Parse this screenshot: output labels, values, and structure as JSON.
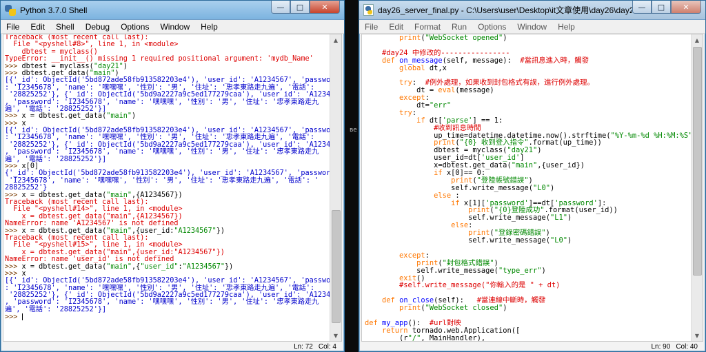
{
  "shell": {
    "title": "Python 3.7.0 Shell",
    "menu": [
      "File",
      "Edit",
      "Shell",
      "Debug",
      "Options",
      "Window",
      "Help"
    ],
    "lines": [
      [
        {
          "t": "Traceback (most recent call last):",
          "c": "c-err"
        }
      ],
      [
        {
          "t": "  File \"<pyshell#8>\", line 1, in <module>",
          "c": "c-err"
        }
      ],
      [
        {
          "t": "    dbtest = myclass()",
          "c": "c-err"
        }
      ],
      [
        {
          "t": "TypeError: __init__() missing 1 required positional argument: 'mydb_Name'",
          "c": "c-err"
        }
      ],
      [
        {
          "t": ">>> ",
          "c": "c-prompt"
        },
        {
          "t": "dbtest = myclass(",
          "c": "c-code"
        },
        {
          "t": "\"day21\"",
          "c": "c-str"
        },
        {
          "t": ")",
          "c": "c-code"
        }
      ],
      [
        {
          "t": ">>> ",
          "c": "c-prompt"
        },
        {
          "t": "dbtest.get_data(",
          "c": "c-code"
        },
        {
          "t": "\"main\"",
          "c": "c-str"
        },
        {
          "t": ")",
          "c": "c-code"
        }
      ],
      [
        {
          "t": "[{'_id': ObjectId('5bd872ade58fb913582203e4'), 'user_id': 'A1234567', 'password'",
          "c": "c-out"
        }
      ],
      [
        {
          "t": ": 'I2345678', 'name': '嘿嘿嘿', '性別': '男', '住址': '忠孝東路走九遍', '電話':",
          "c": "c-out"
        }
      ],
      [
        {
          "t": " '28825252'}, {'_id': ObjectId('5bd9a2227a9c5ed177279caa'), 'user_id': 'A1234567'",
          "c": "c-out"
        }
      ],
      [
        {
          "t": ", 'password': 'I2345678', 'name': '嘿嘿嘿', '性別': '男', '住址': '忠孝東路走九",
          "c": "c-out"
        }
      ],
      [
        {
          "t": "遍', '電話': '28825252'}]",
          "c": "c-out"
        }
      ],
      [
        {
          "t": ">>> ",
          "c": "c-prompt"
        },
        {
          "t": "x = dbtest.get_data(",
          "c": "c-code"
        },
        {
          "t": "\"main\"",
          "c": "c-str"
        },
        {
          "t": ")",
          "c": "c-code"
        }
      ],
      [
        {
          "t": ">>> ",
          "c": "c-prompt"
        },
        {
          "t": "x",
          "c": "c-code"
        }
      ],
      [
        {
          "t": "[{'_id': ObjectId('5bd872ade58fb913582203e4'), 'user_id': 'A1234567', 'password'",
          "c": "c-out"
        }
      ],
      [
        {
          "t": ": 'I2345678', 'name': '嘿嘿嘿', '性別': '男', '住址': '忠孝東路走九遍', '電話':",
          "c": "c-out"
        }
      ],
      [
        {
          "t": " '28825252'}, {'_id': ObjectId('5bd9a2227a9c5ed177279caa'), 'user_id': 'A1234567'",
          "c": "c-out"
        }
      ],
      [
        {
          "t": ", 'password': 'I2345678', 'name': '嘿嘿嘿', '性別': '男', '住址': '忠孝東路走九",
          "c": "c-out"
        }
      ],
      [
        {
          "t": "遍', '電話': '28825252'}]",
          "c": "c-out"
        }
      ],
      [
        {
          "t": ">>> ",
          "c": "c-prompt"
        },
        {
          "t": "x[0]",
          "c": "c-code"
        }
      ],
      [
        {
          "t": "{'_id': ObjectId('5bd872ade58fb913582203e4'), 'user_id': 'A1234567', 'password':",
          "c": "c-out"
        }
      ],
      [
        {
          "t": " 'I2345678', 'name': '嘿嘿嘿', '性別': '男', '住址': '忠孝東路走九遍', '電話': '",
          "c": "c-out"
        }
      ],
      [
        {
          "t": "28825252'}",
          "c": "c-out"
        }
      ],
      [
        {
          "t": ">>> ",
          "c": "c-prompt"
        },
        {
          "t": "x = dbtest.get_data(",
          "c": "c-code"
        },
        {
          "t": "\"main\"",
          "c": "c-str"
        },
        {
          "t": ",{A1234567})",
          "c": "c-code"
        }
      ],
      [
        {
          "t": "Traceback (most recent call last):",
          "c": "c-err"
        }
      ],
      [
        {
          "t": "  File \"<pyshell#14>\", line 1, in <module>",
          "c": "c-err"
        }
      ],
      [
        {
          "t": "    x = dbtest.get_data(\"main\",{A1234567})",
          "c": "c-err"
        }
      ],
      [
        {
          "t": "NameError: name 'A1234567' is not defined",
          "c": "c-err"
        }
      ],
      [
        {
          "t": ">>> ",
          "c": "c-prompt"
        },
        {
          "t": "x = dbtest.get_data(",
          "c": "c-code"
        },
        {
          "t": "\"main\"",
          "c": "c-str"
        },
        {
          "t": ",{user_id:",
          "c": "c-code"
        },
        {
          "t": "\"A1234567\"",
          "c": "c-str"
        },
        {
          "t": "})",
          "c": "c-code"
        }
      ],
      [
        {
          "t": "Traceback (most recent call last):",
          "c": "c-err"
        }
      ],
      [
        {
          "t": "  File \"<pyshell#15>\", line 1, in <module>",
          "c": "c-err"
        }
      ],
      [
        {
          "t": "    x = dbtest.get_data(\"main\",{user_id:\"A1234567\"})",
          "c": "c-err"
        }
      ],
      [
        {
          "t": "NameError: name 'user_id' is not defined",
          "c": "c-err"
        }
      ],
      [
        {
          "t": ">>> ",
          "c": "c-prompt"
        },
        {
          "t": "x = dbtest.get_data(",
          "c": "c-code"
        },
        {
          "t": "\"main\"",
          "c": "c-str"
        },
        {
          "t": ",{",
          "c": "c-code"
        },
        {
          "t": "\"user_id\"",
          "c": "c-str"
        },
        {
          "t": ":",
          "c": "c-code"
        },
        {
          "t": "\"A1234567\"",
          "c": "c-str"
        },
        {
          "t": "})",
          "c": "c-code"
        }
      ],
      [
        {
          "t": ">>> ",
          "c": "c-prompt"
        },
        {
          "t": "x",
          "c": "c-code"
        }
      ],
      [
        {
          "t": "[{'_id': ObjectId('5bd872ade58fb913582203e4'), 'user_id': 'A1234567', 'password'",
          "c": "c-out"
        }
      ],
      [
        {
          "t": ": 'I2345678', 'name': '嘿嘿嘿', '性別': '男', '住址': '忠孝東路走九遍', '電話':",
          "c": "c-out"
        }
      ],
      [
        {
          "t": " '28825252'}, {'_id': ObjectId('5bd9a2227a9c5ed177279caa'), 'user_id': 'A1234567'",
          "c": "c-out"
        }
      ],
      [
        {
          "t": ", 'password': 'I2345678', 'name': '嘿嘿嘿', '性別': '男', '住址': '忠孝東路走九",
          "c": "c-out"
        }
      ],
      [
        {
          "t": "遍', '電話': '28825252'}]",
          "c": "c-out"
        }
      ],
      [
        {
          "t": ">>> ",
          "c": "c-prompt"
        }
      ]
    ],
    "status": {
      "ln": "Ln: 72",
      "col": "Col: 4"
    }
  },
  "editor": {
    "title": "day26_server_final.py - C:\\Users\\user\\Desktop\\it文章使用\\day26\\day26_server_fi...",
    "menu": [
      "File",
      "Edit",
      "Format",
      "Run",
      "Options",
      "Window",
      "Help"
    ],
    "lines": [
      [
        {
          "t": "        "
        },
        {
          "t": "print",
          "c": "c-kw"
        },
        {
          "t": "("
        },
        {
          "t": "\"WebSocket opened\"",
          "c": "c-str"
        },
        {
          "t": ")"
        }
      ],
      [
        {
          "t": ""
        }
      ],
      [
        {
          "t": "    #day24 中修改的----------------",
          "c": "c-cmt"
        }
      ],
      [
        {
          "t": "    "
        },
        {
          "t": "def ",
          "c": "c-kw"
        },
        {
          "t": "on_message",
          "c": "c-def"
        },
        {
          "t": "(self, message):  "
        },
        {
          "t": "#當訊息進入時，觸發",
          "c": "c-cmt"
        }
      ],
      [
        {
          "t": "        "
        },
        {
          "t": "global ",
          "c": "c-kw"
        },
        {
          "t": "dt,x"
        }
      ],
      [
        {
          "t": ""
        }
      ],
      [
        {
          "t": "        "
        },
        {
          "t": "try",
          "c": "c-kw"
        },
        {
          "t": ":  "
        },
        {
          "t": "#例外處理，如果收到封包格式有誤，進行例外處理。",
          "c": "c-cmt"
        }
      ],
      [
        {
          "t": "            dt = "
        },
        {
          "t": "eval",
          "c": "c-kw"
        },
        {
          "t": "(message)"
        }
      ],
      [
        {
          "t": "        "
        },
        {
          "t": "except",
          "c": "c-kw"
        },
        {
          "t": ":"
        }
      ],
      [
        {
          "t": "            dt="
        },
        {
          "t": "\"err\"",
          "c": "c-str"
        }
      ],
      [
        {
          "t": "        "
        },
        {
          "t": "try",
          "c": "c-kw"
        },
        {
          "t": ":"
        }
      ],
      [
        {
          "t": "            "
        },
        {
          "t": "if ",
          "c": "c-kw"
        },
        {
          "t": "dt["
        },
        {
          "t": "'parse'",
          "c": "c-str"
        },
        {
          "t": "] == 1:"
        }
      ],
      [
        {
          "t": "                "
        },
        {
          "t": "#收到訊息時間",
          "c": "c-cmt"
        }
      ],
      [
        {
          "t": "                up_time=datetime.datetime.now().strftime("
        },
        {
          "t": "\"%Y-%m-%d %H:%M:%S\"",
          "c": "c-str"
        },
        {
          "t": ")"
        }
      ],
      [
        {
          "t": "                "
        },
        {
          "t": "print",
          "c": "c-kw"
        },
        {
          "t": "("
        },
        {
          "t": "\"{0} 收到登入指令\"",
          "c": "c-str"
        },
        {
          "t": ".format(up_time))"
        }
      ],
      [
        {
          "t": "                dbtest = myclass("
        },
        {
          "t": "\"day21\"",
          "c": "c-str"
        },
        {
          "t": ")"
        }
      ],
      [
        {
          "t": "                user_id=dt["
        },
        {
          "t": "'user_id'",
          "c": "c-str"
        },
        {
          "t": "]"
        }
      ],
      [
        {
          "t": "                x=dbtest.get_data("
        },
        {
          "t": "\"main\"",
          "c": "c-str"
        },
        {
          "t": ",{user_id})"
        }
      ],
      [
        {
          "t": "                "
        },
        {
          "t": "if ",
          "c": "c-kw"
        },
        {
          "t": "x[0]== 0:"
        }
      ],
      [
        {
          "t": "                    "
        },
        {
          "t": "print",
          "c": "c-kw"
        },
        {
          "t": "("
        },
        {
          "t": "\"登陸帳號錯誤\"",
          "c": "c-str"
        },
        {
          "t": ")"
        }
      ],
      [
        {
          "t": "                    self.write_message("
        },
        {
          "t": "\"L0\"",
          "c": "c-str"
        },
        {
          "t": ")"
        }
      ],
      [
        {
          "t": "                "
        },
        {
          "t": "else ",
          "c": "c-kw"
        },
        {
          "t": ":"
        }
      ],
      [
        {
          "t": "                    "
        },
        {
          "t": "if ",
          "c": "c-kw"
        },
        {
          "t": "x[1]["
        },
        {
          "t": "'password'",
          "c": "c-str"
        },
        {
          "t": "]==dt["
        },
        {
          "t": "'password'",
          "c": "c-str"
        },
        {
          "t": "]:"
        }
      ],
      [
        {
          "t": "                        "
        },
        {
          "t": "print",
          "c": "c-kw"
        },
        {
          "t": "("
        },
        {
          "t": "\"{0}登陸成功\"",
          "c": "c-str"
        },
        {
          "t": ".format(user_id))"
        }
      ],
      [
        {
          "t": "                        self.write_message("
        },
        {
          "t": "\"L1\"",
          "c": "c-str"
        },
        {
          "t": ")"
        }
      ],
      [
        {
          "t": "                    "
        },
        {
          "t": "else",
          "c": "c-kw"
        },
        {
          "t": ":"
        }
      ],
      [
        {
          "t": "                        "
        },
        {
          "t": "print",
          "c": "c-kw"
        },
        {
          "t": "("
        },
        {
          "t": "\"登錄密碼錯誤\"",
          "c": "c-str"
        },
        {
          "t": ")"
        }
      ],
      [
        {
          "t": "                        self.write_message("
        },
        {
          "t": "\"L0\"",
          "c": "c-str"
        },
        {
          "t": ")"
        }
      ],
      [
        {
          "t": ""
        }
      ],
      [
        {
          "t": "        "
        },
        {
          "t": "except",
          "c": "c-kw"
        },
        {
          "t": ":"
        }
      ],
      [
        {
          "t": "            "
        },
        {
          "t": "print",
          "c": "c-kw"
        },
        {
          "t": "("
        },
        {
          "t": "\"封包格式錯誤\"",
          "c": "c-str"
        },
        {
          "t": ")"
        }
      ],
      [
        {
          "t": "            self.write_message("
        },
        {
          "t": "\"type_err\"",
          "c": "c-str"
        },
        {
          "t": ")"
        }
      ],
      [
        {
          "t": "        "
        },
        {
          "t": "exit",
          "c": "c-kw"
        },
        {
          "t": "()"
        }
      ],
      [
        {
          "t": "        "
        },
        {
          "t": "#self.write_message(\"你輸入的是 \" + dt)",
          "c": "c-cmt"
        }
      ],
      [
        {
          "t": ""
        }
      ],
      [
        {
          "t": "    "
        },
        {
          "t": "def ",
          "c": "c-kw"
        },
        {
          "t": "on_close",
          "c": "c-def"
        },
        {
          "t": "(self):   "
        },
        {
          "t": "#當連線中斷時，觸發",
          "c": "c-cmt"
        }
      ],
      [
        {
          "t": "        "
        },
        {
          "t": "print",
          "c": "c-kw"
        },
        {
          "t": "("
        },
        {
          "t": "\"WebSocket closed\"",
          "c": "c-str"
        },
        {
          "t": ")"
        }
      ],
      [
        {
          "t": ""
        }
      ],
      [
        {
          "t": ""
        },
        {
          "t": "def ",
          "c": "c-kw"
        },
        {
          "t": "my_app",
          "c": "c-def"
        },
        {
          "t": "():  "
        },
        {
          "t": "#url對映",
          "c": "c-cmt"
        }
      ],
      [
        {
          "t": "    "
        },
        {
          "t": "return ",
          "c": "c-kw"
        },
        {
          "t": "tornado.web.Application(["
        }
      ],
      [
        {
          "t": "        (r"
        },
        {
          "t": "\"/\"",
          "c": "c-str"
        },
        {
          "t": ", MainHandler),"
        }
      ]
    ],
    "status": {
      "ln": "Ln: 90",
      "col": "Col: 40"
    }
  },
  "desktop": {
    "gap_label": "ве"
  }
}
